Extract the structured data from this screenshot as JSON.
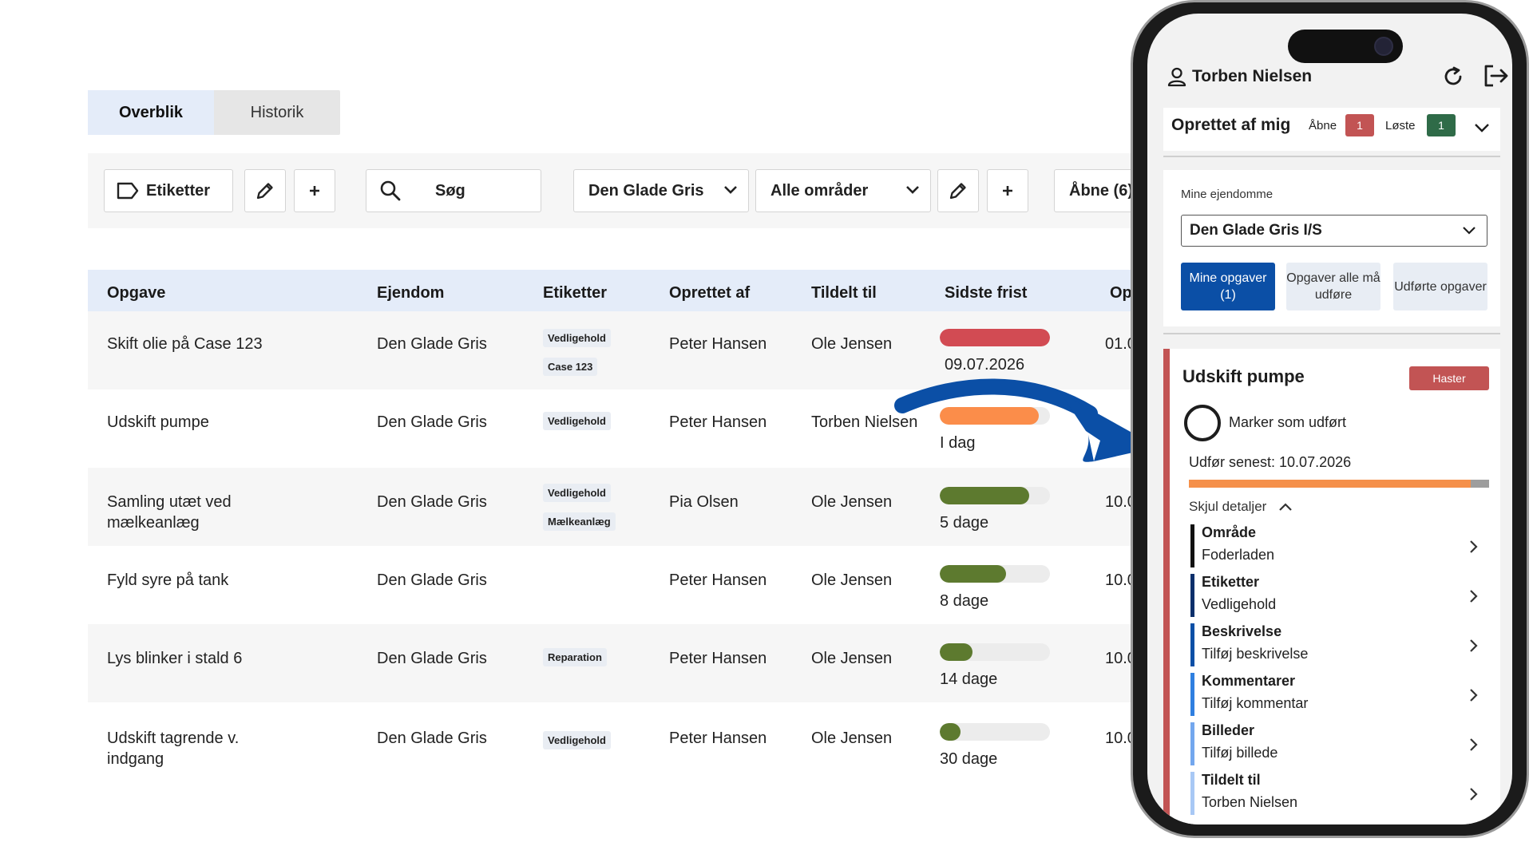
{
  "tabs": [
    {
      "label": "Overblik",
      "active": true
    },
    {
      "label": "Historik",
      "active": false
    }
  ],
  "toolbar": {
    "labels_button": "Etiketter",
    "search_label": "Søg",
    "property_select": "Den Glade Gris",
    "area_select": "Alle områder",
    "open_button": "Åbne (6)"
  },
  "table": {
    "columns": [
      "Opgave",
      "Ejendom",
      "Etiketter",
      "Oprettet af",
      "Tildelt til",
      "Sidste frist",
      "Opr"
    ],
    "rows": [
      {
        "task": "Skift olie på Case 123",
        "property": "Den Glade Gris",
        "tags": [
          "Vedligehold",
          "Case 123"
        ],
        "created_by": "Peter Hansen",
        "assigned_to": "Ole Jensen",
        "deadline": "09.07.2026",
        "progress": 1.0,
        "color": "#d24b53",
        "created": "01.0"
      },
      {
        "task": "Udskift pumpe",
        "property": "Den Glade Gris",
        "tags": [
          "Vedligehold"
        ],
        "created_by": "Peter Hansen",
        "assigned_to": "Torben Nielsen",
        "deadline": "I dag",
        "progress": 0.9,
        "color": "#fb8d4a",
        "created": ""
      },
      {
        "task": "Samling utæt ved mælkeanlæg",
        "property": "Den Glade Gris",
        "tags": [
          "Vedligehold",
          "Mælkeanlæg"
        ],
        "created_by": "Pia Olsen",
        "assigned_to": "Ole Jensen",
        "deadline": "5 dage",
        "progress": 0.81,
        "color": "#5d7a2f",
        "created": "10.0"
      },
      {
        "task": "Fyld syre på tank",
        "property": "Den Glade Gris",
        "tags": [],
        "created_by": "Peter Hansen",
        "assigned_to": "Ole Jensen",
        "deadline": "8 dage",
        "progress": 0.6,
        "color": "#5d7a2f",
        "created": "10.0"
      },
      {
        "task": "Lys blinker i stald 6",
        "property": "Den Glade Gris",
        "tags": [
          "Reparation"
        ],
        "created_by": "Peter Hansen",
        "assigned_to": "Ole Jensen",
        "deadline": "14 dage",
        "progress": 0.3,
        "color": "#5d7a2f",
        "created": "10.0"
      },
      {
        "task": "Udskift tagrende v. indgang",
        "property": "Den Glade Gris",
        "tags": [
          "Vedligehold"
        ],
        "created_by": "Peter Hansen",
        "assigned_to": "Ole Jensen",
        "deadline": "30 dage",
        "progress": 0.19,
        "color": "#5d7a2f",
        "created": "10.0"
      }
    ]
  },
  "phone": {
    "user_name": "Torben Nielsen",
    "created_by_me": {
      "title": "Oprettet af mig",
      "open_label": "Åbne",
      "open_count": "1",
      "open_color": "#c25454",
      "solved_label": "Løste",
      "solved_count": "1",
      "solved_color": "#2f6b48"
    },
    "my_properties": {
      "label": "Mine ejendomme",
      "selected": "Den Glade Gris I/S"
    },
    "segments": [
      {
        "label": "Mine opgaver (1)",
        "active": true
      },
      {
        "label": "Opgaver alle må udføre",
        "active": false
      },
      {
        "label": "Udførte opgaver",
        "active": false
      }
    ],
    "task": {
      "title": "Udskift pumpe",
      "badge": "Haster",
      "mark_done": "Marker som udført",
      "deadline": "Udfør senest: 10.07.2026",
      "progress": 0.94,
      "hide_details": "Skjul detaljer",
      "details": [
        {
          "label": "Område",
          "value": "Foderladen",
          "color": "#111111"
        },
        {
          "label": "Etiketter",
          "value": "Vedligehold",
          "color": "#0b2f6b"
        },
        {
          "label": "Beskrivelse",
          "value": "Tilføj beskrivelse",
          "color": "#0b4fa6"
        },
        {
          "label": "Kommentarer",
          "value": "Tilføj kommentar",
          "color": "#2f7fe0"
        },
        {
          "label": "Billeder",
          "value": "Tilføj billede",
          "color": "#73a7ee"
        },
        {
          "label": "Tildelt til",
          "value": "Torben Nielsen",
          "color": "#a8c8f5"
        }
      ]
    }
  },
  "colors": {
    "accent": "#0b4fa6",
    "arrow": "#0b4fa6",
    "header_bg": "#e4ecf9"
  }
}
